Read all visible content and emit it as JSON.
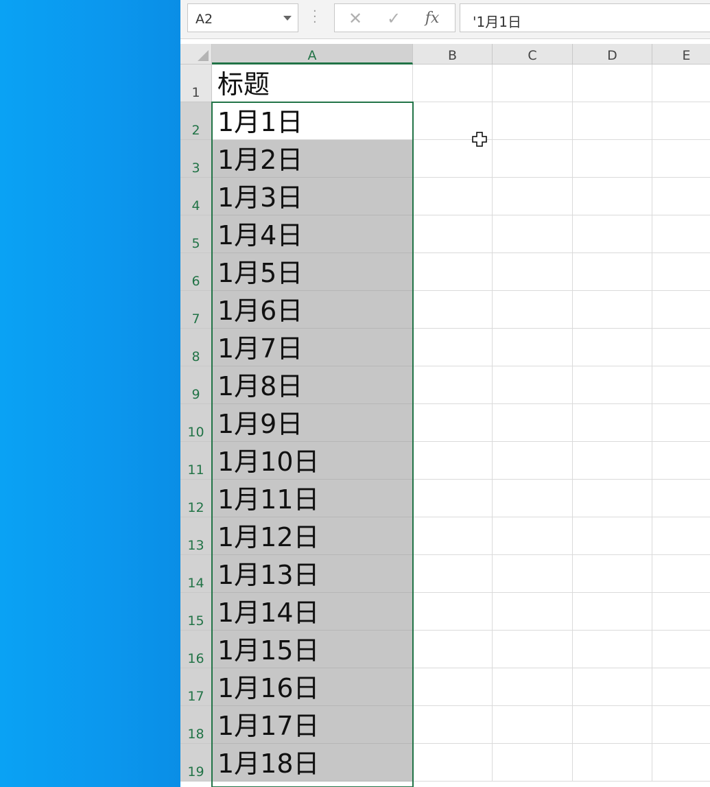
{
  "formula_bar": {
    "name_box": "A2",
    "cancel_icon": "close-icon",
    "enter_icon": "check-icon",
    "fx_label": "fx",
    "formula": "'1月1日"
  },
  "columns": [
    "A",
    "B",
    "C",
    "D",
    "E"
  ],
  "rows": [
    "1",
    "2",
    "3",
    "4",
    "5",
    "6",
    "7",
    "8",
    "9",
    "10",
    "11",
    "12",
    "13",
    "14",
    "15",
    "16",
    "17",
    "18",
    "19"
  ],
  "column_a": [
    "标题",
    "1月1日",
    "1月2日",
    "1月3日",
    "1月4日",
    "1月5日",
    "1月6日",
    "1月7日",
    "1月8日",
    "1月9日",
    "1月10日",
    "1月11日",
    "1月12日",
    "1月13日",
    "1月14日",
    "1月15日",
    "1月16日",
    "1月17日",
    "1月18日"
  ],
  "active_cell": "A2",
  "selection": "A2:A19",
  "colors": {
    "desktop": "#0a97ee",
    "selection_border": "#217346",
    "selection_fill": "#c6c6c6",
    "header_bg": "#e6e6e6"
  }
}
